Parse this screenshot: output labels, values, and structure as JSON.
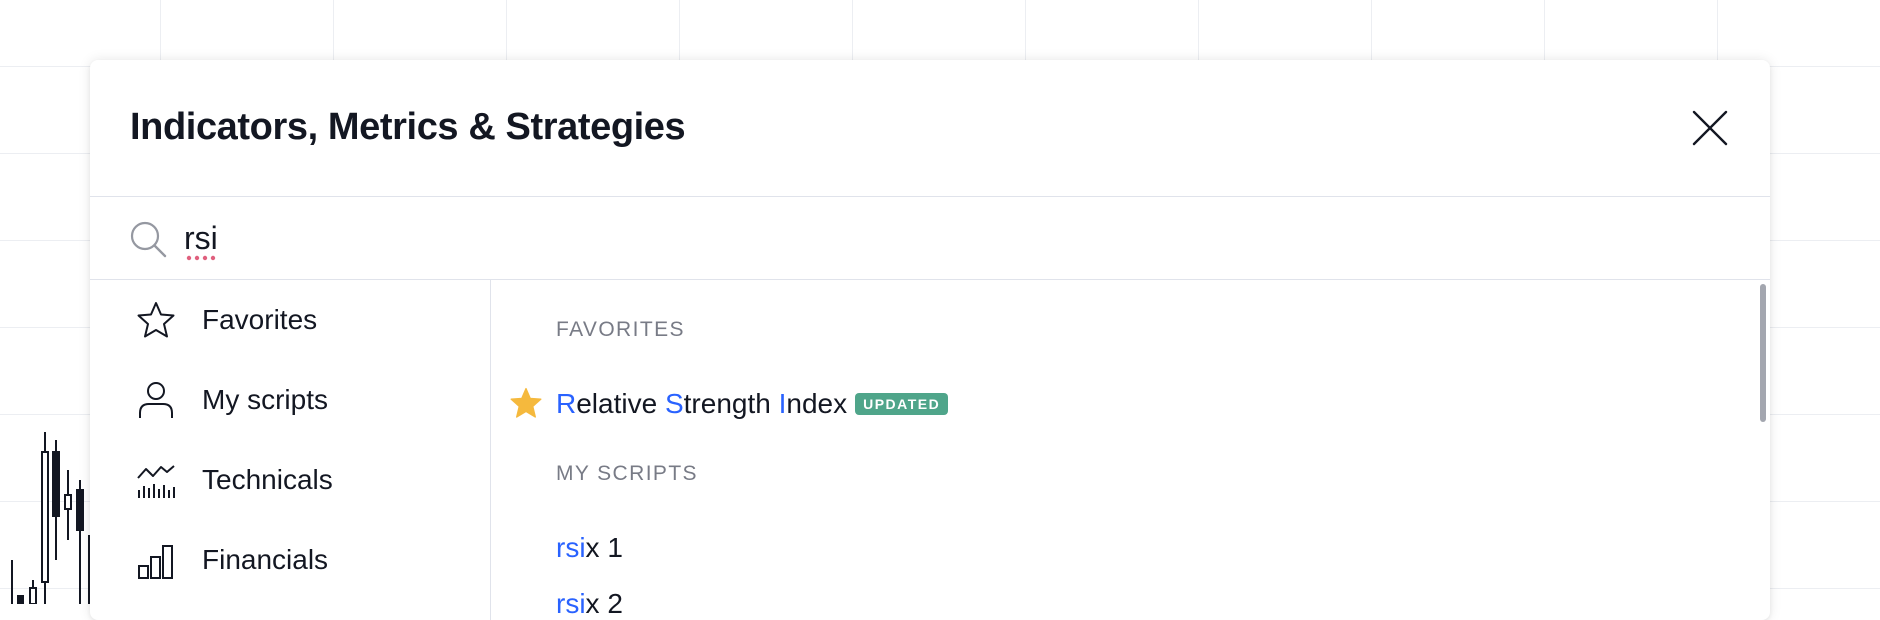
{
  "dialog": {
    "title": "Indicators, Metrics & Strategies",
    "close_icon": "close-icon"
  },
  "search": {
    "value": "rsi",
    "icon": "search-icon"
  },
  "sidebar": {
    "items": [
      {
        "label": "Favorites",
        "icon": "star-icon"
      },
      {
        "label": "My scripts",
        "icon": "user-icon"
      },
      {
        "label": "Technicals",
        "icon": "technicals-icon"
      },
      {
        "label": "Financials",
        "icon": "financials-icon"
      }
    ]
  },
  "results": {
    "favorites_header": "FAVORITES",
    "favorites": [
      {
        "parts": [
          {
            "text": "R",
            "hl": true
          },
          {
            "text": "elative ",
            "hl": false
          },
          {
            "text": "S",
            "hl": true
          },
          {
            "text": "trength ",
            "hl": false
          },
          {
            "text": "I",
            "hl": true
          },
          {
            "text": "ndex",
            "hl": false
          }
        ],
        "badge": "UPDATED",
        "favorited": true
      }
    ],
    "my_scripts_header": "MY SCRIPTS",
    "my_scripts": [
      {
        "parts": [
          {
            "text": "rsi",
            "hl": true
          },
          {
            "text": "x 1",
            "hl": false
          }
        ]
      },
      {
        "parts": [
          {
            "text": "rsi",
            "hl": true
          },
          {
            "text": "x 2",
            "hl": false
          }
        ]
      }
    ]
  },
  "colors": {
    "highlight": "#2962ff",
    "badge": "#4fa58a",
    "star": "#f5b93d",
    "section_header": "#787b86",
    "text": "#131722"
  }
}
